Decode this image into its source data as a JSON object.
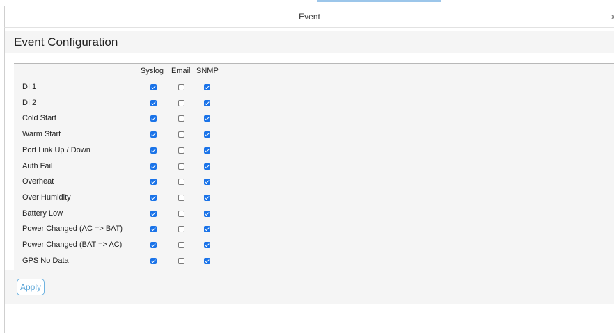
{
  "window": {
    "title": "Event",
    "close_glyph": "x"
  },
  "page": {
    "heading": "Event Configuration"
  },
  "columns": {
    "syslog": "Syslog",
    "email": "Email",
    "snmp": "SNMP"
  },
  "events": [
    {
      "label": "DI 1",
      "syslog": true,
      "email": false,
      "snmp": true
    },
    {
      "label": "DI 2",
      "syslog": true,
      "email": false,
      "snmp": true
    },
    {
      "label": "Cold Start",
      "syslog": true,
      "email": false,
      "snmp": true
    },
    {
      "label": "Warm Start",
      "syslog": true,
      "email": false,
      "snmp": true
    },
    {
      "label": "Port Link Up / Down",
      "syslog": true,
      "email": false,
      "snmp": true
    },
    {
      "label": "Auth Fail",
      "syslog": true,
      "email": false,
      "snmp": true
    },
    {
      "label": "Overheat",
      "syslog": true,
      "email": false,
      "snmp": true
    },
    {
      "label": "Over Humidity",
      "syslog": true,
      "email": false,
      "snmp": true
    },
    {
      "label": "Battery Low",
      "syslog": true,
      "email": false,
      "snmp": true
    },
    {
      "label": "Power Changed (AC => BAT)",
      "syslog": true,
      "email": false,
      "snmp": true
    },
    {
      "label": "Power Changed (BAT => AC)",
      "syslog": true,
      "email": false,
      "snmp": true
    },
    {
      "label": "GPS No Data",
      "syslog": true,
      "email": false,
      "snmp": true
    }
  ],
  "actions": {
    "apply_label": "Apply"
  },
  "colors": {
    "accent": "#1a73e8",
    "button_text": "#5aa5d8",
    "panel_bg": "#f5f5f5"
  }
}
